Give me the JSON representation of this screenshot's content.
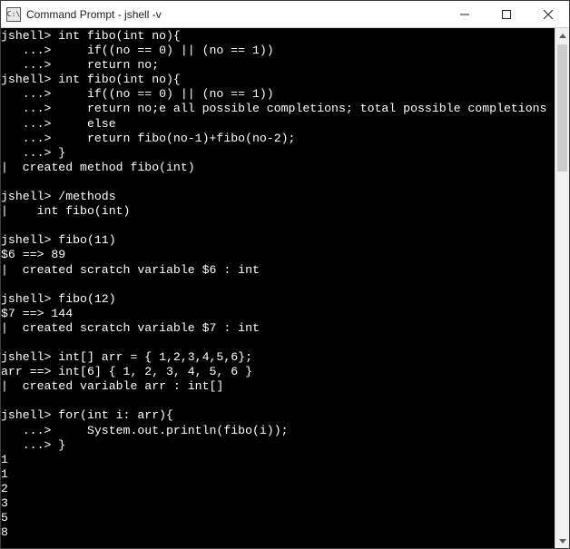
{
  "titlebar": {
    "icon_label": "C:\\",
    "title": "Command Prompt - jshell  -v"
  },
  "terminal": {
    "lines": [
      "jshell> int fibo(int no){",
      "   ...>     if((no == 0) || (no == 1))",
      "   ...>     return no;",
      "jshell> int fibo(int no){",
      "   ...>     if((no == 0) || (no == 1))",
      "   ...>     return no;e all possible completions; total possible completions",
      "   ...>     else",
      "   ...>     return fibo(no-1)+fibo(no-2);",
      "   ...> }",
      "|  created method fibo(int)",
      "",
      "jshell> /methods",
      "|    int fibo(int)",
      "",
      "jshell> fibo(11)",
      "$6 ==> 89",
      "|  created scratch variable $6 : int",
      "",
      "jshell> fibo(12)",
      "$7 ==> 144",
      "|  created scratch variable $7 : int",
      "",
      "jshell> int[] arr = { 1,2,3,4,5,6};",
      "arr ==> int[6] { 1, 2, 3, 4, 5, 6 }",
      "|  created variable arr : int[]",
      "",
      "jshell> for(int i: arr){",
      "   ...>     System.out.println(fibo(i));",
      "   ...> }",
      "1",
      "1",
      "2",
      "3",
      "5",
      "8"
    ]
  }
}
